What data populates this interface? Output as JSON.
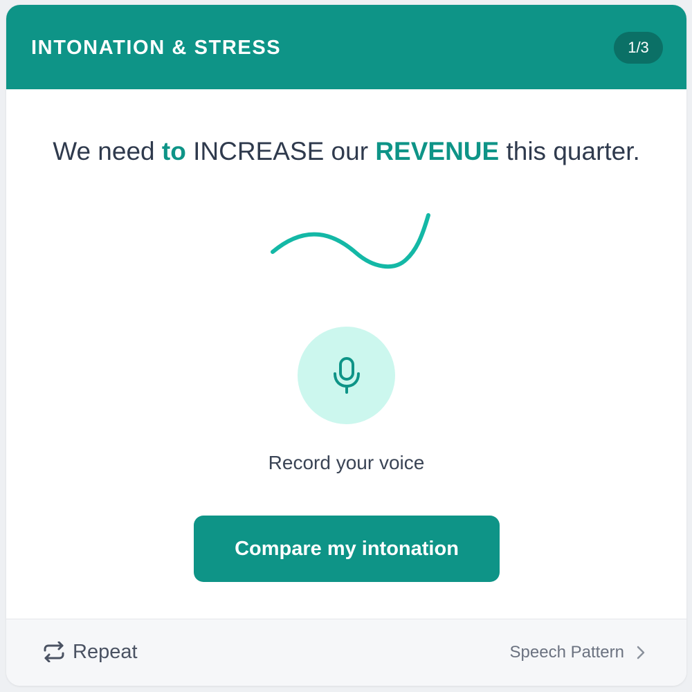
{
  "header": {
    "title": "INTONATION & STRESS",
    "step": "1/3"
  },
  "sentence": {
    "part1": "We need ",
    "stress1": "to",
    "part2": " INCREASE our ",
    "stress2": "REVENUE",
    "part3": " this quarter."
  },
  "recorder": {
    "mic_icon": "microphone-icon",
    "label": "Record your voice"
  },
  "actions": {
    "compare_label": "Compare my intonation"
  },
  "footer": {
    "repeat_label": "Repeat",
    "repeat_icon": "repeat-icon",
    "pattern_label": "Speech Pattern",
    "pattern_icon": "chevron-right-icon"
  },
  "colors": {
    "accent": "#0e9487",
    "accent_dark": "#0b7066",
    "mic_bg": "#ccf7ee",
    "contour": "#14b8a6",
    "text": "#2f3a4d"
  }
}
